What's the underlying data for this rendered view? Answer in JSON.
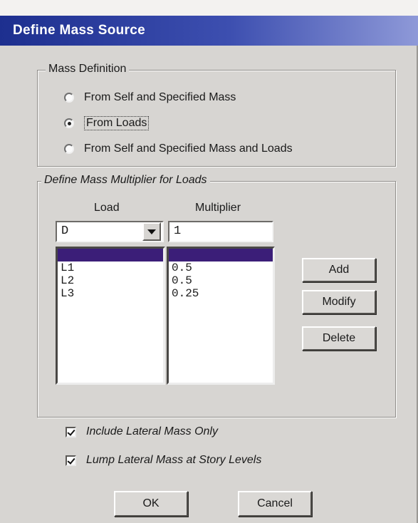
{
  "window": {
    "title": "Define Mass Source"
  },
  "mass_definition": {
    "label": "Mass Definition",
    "options": [
      {
        "label": "From Self and Specified Mass",
        "checked": false
      },
      {
        "label": "From Loads",
        "checked": true
      },
      {
        "label": "From Self and Specified Mass and Loads",
        "checked": false
      }
    ]
  },
  "multiplier": {
    "label": "Define Mass Multiplier for Loads",
    "load_header": "Load",
    "multiplier_header": "Multiplier",
    "load_value": "D",
    "multiplier_value": "1",
    "loads": [
      "L1",
      "L2",
      "L3"
    ],
    "multipliers": [
      "0.5",
      "0.5",
      "0.25"
    ]
  },
  "actions": {
    "add": "Add",
    "modify": "Modify",
    "delete": "Delete"
  },
  "options": {
    "include_lateral": {
      "label": "Include Lateral Mass Only",
      "checked": true
    },
    "lump_lateral": {
      "label": "Lump Lateral Mass at Story Levels",
      "checked": true
    }
  },
  "footer": {
    "ok": "OK",
    "cancel": "Cancel"
  }
}
